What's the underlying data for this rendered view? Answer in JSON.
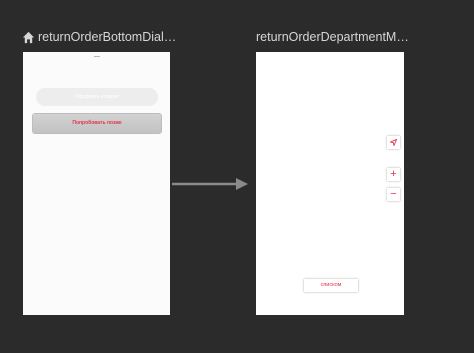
{
  "screens": [
    {
      "title": "returnOrderBottomDial…",
      "is_start_screen": true,
      "primary_button": {
        "label": "Оформить возврат",
        "enabled": false
      },
      "retry_button": {
        "label": "Попробовать позже"
      }
    },
    {
      "title": "returnOrderDepartmentM…",
      "map_controls": {
        "locate_icon": "navigation-arrow-icon",
        "zoom_in_label": "+",
        "zoom_out_label": "−"
      },
      "list_button": {
        "label": "списком"
      }
    }
  ],
  "colors": {
    "canvas_background": "#2b2b2c",
    "accent": "#e4334e",
    "arrow": "#8a8a8a"
  }
}
